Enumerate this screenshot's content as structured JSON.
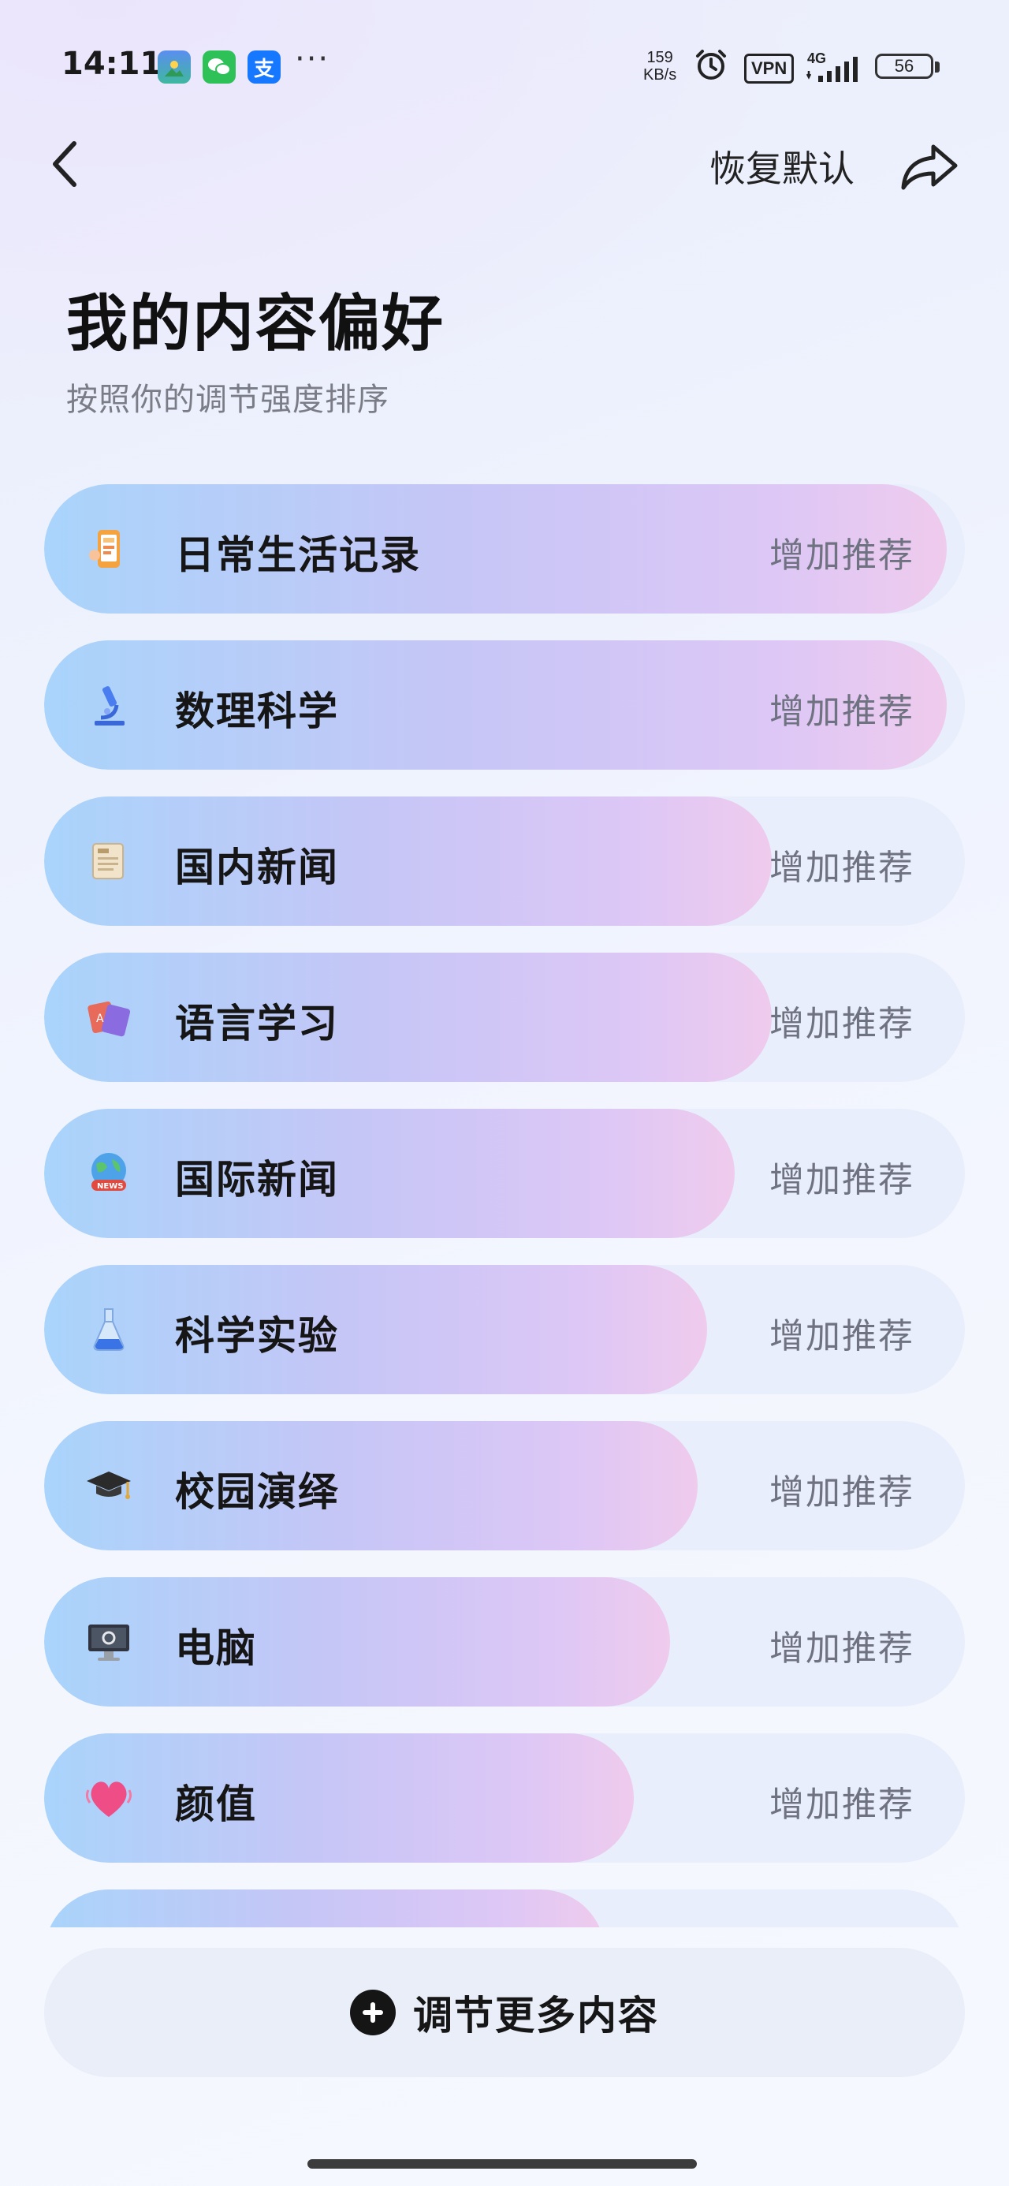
{
  "status_bar": {
    "time": "14:11",
    "network_speed_value": "159",
    "network_speed_unit": "KB/s",
    "vpn_label": "VPN",
    "network_type": "4G",
    "battery": "56",
    "more_indicator": "···"
  },
  "header": {
    "restore_label": "恢复默认"
  },
  "page": {
    "title": "我的内容偏好",
    "subtitle": "按照你的调节强度排序"
  },
  "preferences": [
    {
      "label": "日常生活记录",
      "action": "增加推荐",
      "level": 0.98,
      "icon": "phone-life-icon"
    },
    {
      "label": "数理科学",
      "action": "增加推荐",
      "level": 0.98,
      "icon": "microscope-icon"
    },
    {
      "label": "国内新闻",
      "action": "增加推荐",
      "level": 0.79,
      "icon": "newspaper-icon"
    },
    {
      "label": "语言学习",
      "action": "增加推荐",
      "level": 0.79,
      "icon": "language-cards-icon"
    },
    {
      "label": "国际新闻",
      "action": "增加推荐",
      "level": 0.75,
      "icon": "globe-news-icon"
    },
    {
      "label": "科学实验",
      "action": "增加推荐",
      "level": 0.72,
      "icon": "flask-icon"
    },
    {
      "label": "校园演绎",
      "action": "增加推荐",
      "level": 0.71,
      "icon": "graduation-cap-icon"
    },
    {
      "label": "电脑",
      "action": "增加推荐",
      "level": 0.68,
      "icon": "computer-icon"
    },
    {
      "label": "颜值",
      "action": "增加推荐",
      "level": 0.64,
      "icon": "heart-icon"
    },
    {
      "label": "",
      "action": "",
      "level": 0.61,
      "icon": ""
    }
  ],
  "footer": {
    "more_label": "调节更多内容"
  },
  "colors": {
    "fill_start": "#a9d4fb",
    "fill_end": "#efcbed",
    "track": "#e8eefb",
    "text": "#161616",
    "muted": "#6f7280"
  }
}
